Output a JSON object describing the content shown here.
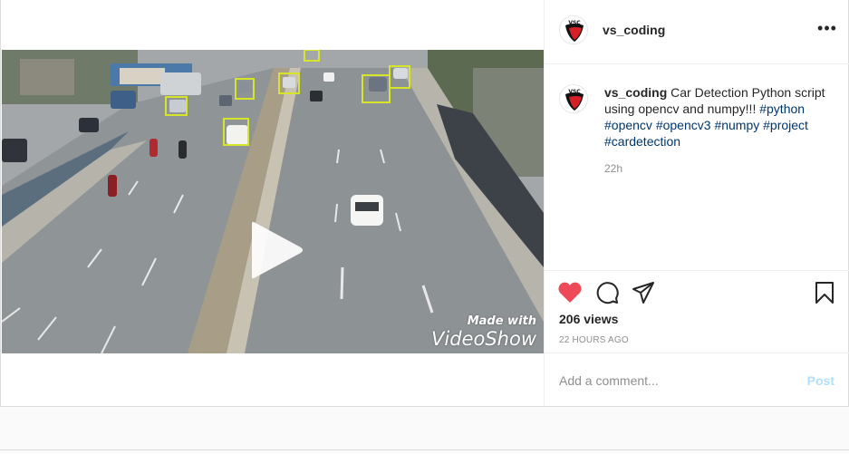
{
  "post": {
    "username": "vs_coding",
    "avatar_text": "VSC",
    "more_icon": "more-horizontal-icon",
    "caption": {
      "username": "vs_coding",
      "text": " Car Detection Python script using opencv and numpy!!! ",
      "hashtags": [
        "#python",
        "#opencv",
        "#opencv3",
        "#numpy",
        "#project",
        "#cardetection"
      ],
      "time": "22h"
    },
    "video": {
      "watermark_small": "Made with",
      "watermark_big": "VideoShow",
      "play_icon": "play-icon",
      "detection_box_color": "#d7e52a"
    },
    "actions": {
      "like_icon": "heart-filled-icon",
      "like_color": "#ed4956",
      "comment_icon": "comment-icon",
      "share_icon": "send-icon",
      "save_icon": "bookmark-icon"
    },
    "views": "206 views",
    "age": "22 HOURS AGO",
    "comment": {
      "placeholder": "Add a comment...",
      "post_label": "Post"
    }
  }
}
